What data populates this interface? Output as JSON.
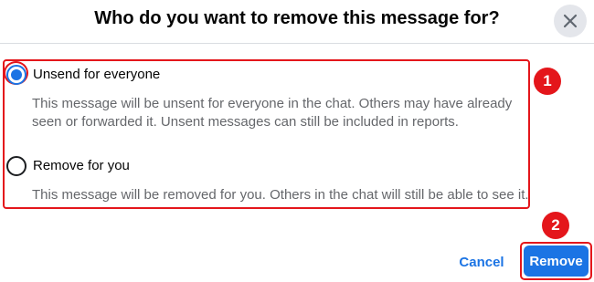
{
  "dialog": {
    "title": "Who do you want to remove this message for?",
    "close_icon": "close-icon"
  },
  "options": [
    {
      "label": "Unsend for everyone",
      "description": "This message will be unsent for everyone in the chat. Others may have already seen or forwarded it. Unsent messages can still be included in reports.",
      "selected": true
    },
    {
      "label": "Remove for you",
      "description": "This message will be removed for you. Others in the chat will still be able to see it.",
      "selected": false
    }
  ],
  "annotations": {
    "step1": "1",
    "step2": "2"
  },
  "actions": {
    "cancel_label": "Cancel",
    "remove_label": "Remove"
  },
  "colors": {
    "accent": "#1b74e4",
    "annotation": "#e4161b",
    "secondary_text": "#65676b"
  }
}
